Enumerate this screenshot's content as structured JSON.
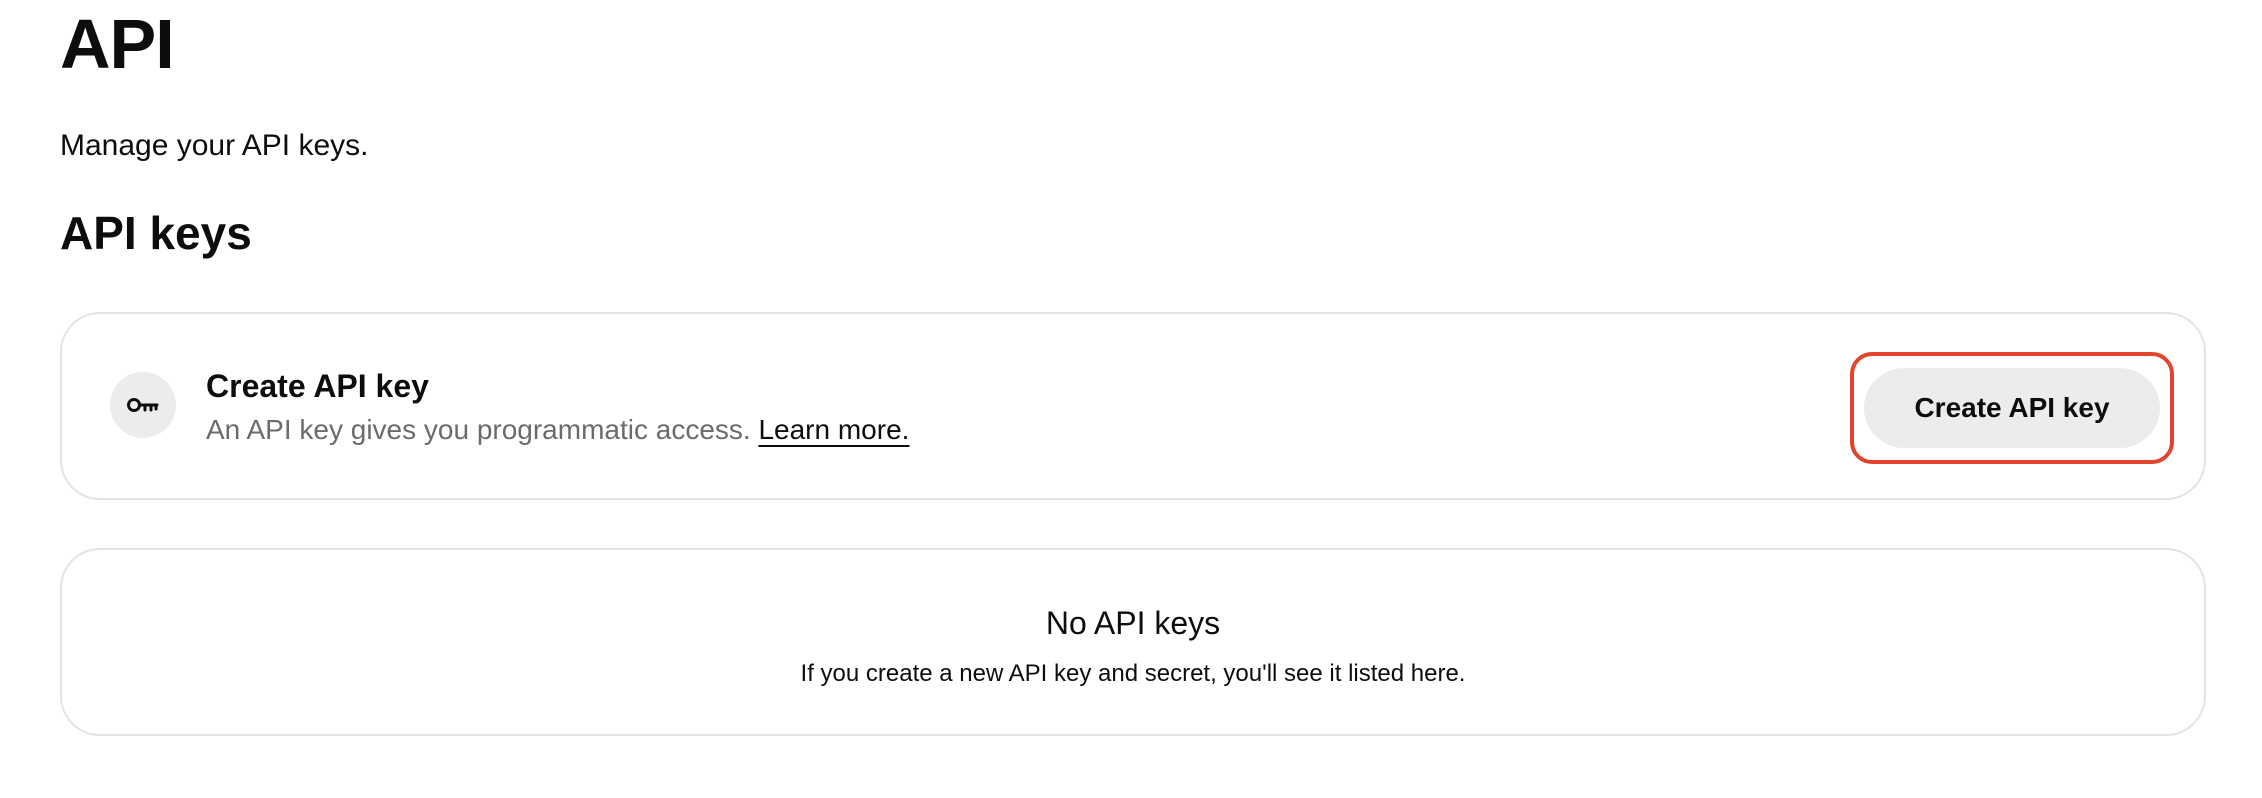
{
  "page": {
    "title": "API",
    "subtitle": "Manage your API keys."
  },
  "api_keys_section": {
    "title": "API keys",
    "create_card": {
      "icon": "key-icon",
      "heading": "Create API key",
      "description": "An API key gives you programmatic access.",
      "learn_more_label": "Learn more.",
      "button_label": "Create API key"
    },
    "empty_state": {
      "title": "No API keys",
      "description": "If you create a new API key and secret, you'll see it listed here."
    }
  },
  "colors": {
    "highlight": "#e0442c",
    "button_bg": "#ececec",
    "muted_text": "#6b6b6b",
    "card_border": "#e3e3e3"
  }
}
